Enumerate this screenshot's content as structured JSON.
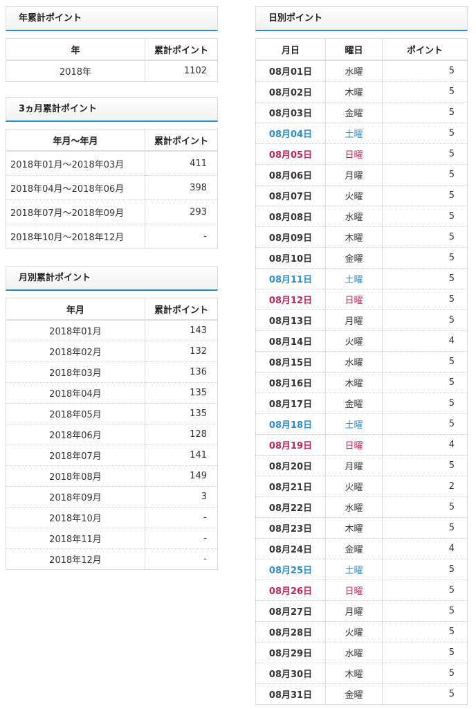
{
  "year_panel": {
    "title": "年累計ポイント",
    "headers": [
      "年",
      "累計ポイント"
    ],
    "rows": [
      {
        "period": "2018年",
        "points": "1102"
      }
    ]
  },
  "quarter_panel": {
    "title": "3ヵ月累計ポイント",
    "headers": [
      "年月～年月",
      "累計ポイント"
    ],
    "rows": [
      {
        "period": "2018年01月～2018年03月",
        "points": "411"
      },
      {
        "period": "2018年04月～2018年06月",
        "points": "398"
      },
      {
        "period": "2018年07月～2018年09月",
        "points": "293"
      },
      {
        "period": "2018年10月～2018年12月",
        "points": "-"
      }
    ]
  },
  "month_panel": {
    "title": "月別累計ポイント",
    "headers": [
      "年月",
      "累計ポイント"
    ],
    "rows": [
      {
        "period": "2018年01月",
        "points": "143"
      },
      {
        "period": "2018年02月",
        "points": "132"
      },
      {
        "period": "2018年03月",
        "points": "136"
      },
      {
        "period": "2018年04月",
        "points": "135"
      },
      {
        "period": "2018年05月",
        "points": "135"
      },
      {
        "period": "2018年06月",
        "points": "128"
      },
      {
        "period": "2018年07月",
        "points": "141"
      },
      {
        "period": "2018年08月",
        "points": "149"
      },
      {
        "period": "2018年09月",
        "points": "3"
      },
      {
        "period": "2018年10月",
        "points": "-"
      },
      {
        "period": "2018年11月",
        "points": "-"
      },
      {
        "period": "2018年12月",
        "points": "-"
      }
    ]
  },
  "daily_panel": {
    "title": "日別ポイント",
    "headers": [
      "月日",
      "曜日",
      "ポイント"
    ],
    "colors": {
      "saturday": "#2a8ccc",
      "sunday": "#c0245a",
      "accent": "#2a8ccc"
    },
    "rows": [
      {
        "date": "08月01日",
        "dow": "水曜",
        "points": "5",
        "day_type": "weekday"
      },
      {
        "date": "08月02日",
        "dow": "木曜",
        "points": "5",
        "day_type": "weekday"
      },
      {
        "date": "08月03日",
        "dow": "金曜",
        "points": "5",
        "day_type": "weekday"
      },
      {
        "date": "08月04日",
        "dow": "土曜",
        "points": "5",
        "day_type": "sat"
      },
      {
        "date": "08月05日",
        "dow": "日曜",
        "points": "5",
        "day_type": "sun"
      },
      {
        "date": "08月06日",
        "dow": "月曜",
        "points": "5",
        "day_type": "weekday"
      },
      {
        "date": "08月07日",
        "dow": "火曜",
        "points": "5",
        "day_type": "weekday"
      },
      {
        "date": "08月08日",
        "dow": "水曜",
        "points": "5",
        "day_type": "weekday"
      },
      {
        "date": "08月09日",
        "dow": "木曜",
        "points": "5",
        "day_type": "weekday"
      },
      {
        "date": "08月10日",
        "dow": "金曜",
        "points": "5",
        "day_type": "weekday"
      },
      {
        "date": "08月11日",
        "dow": "土曜",
        "points": "5",
        "day_type": "sat"
      },
      {
        "date": "08月12日",
        "dow": "日曜",
        "points": "5",
        "day_type": "sun"
      },
      {
        "date": "08月13日",
        "dow": "月曜",
        "points": "5",
        "day_type": "weekday"
      },
      {
        "date": "08月14日",
        "dow": "火曜",
        "points": "4",
        "day_type": "weekday"
      },
      {
        "date": "08月15日",
        "dow": "水曜",
        "points": "5",
        "day_type": "weekday"
      },
      {
        "date": "08月16日",
        "dow": "木曜",
        "points": "5",
        "day_type": "weekday"
      },
      {
        "date": "08月17日",
        "dow": "金曜",
        "points": "5",
        "day_type": "weekday"
      },
      {
        "date": "08月18日",
        "dow": "土曜",
        "points": "5",
        "day_type": "sat"
      },
      {
        "date": "08月19日",
        "dow": "日曜",
        "points": "4",
        "day_type": "sun"
      },
      {
        "date": "08月20日",
        "dow": "月曜",
        "points": "5",
        "day_type": "weekday"
      },
      {
        "date": "08月21日",
        "dow": "火曜",
        "points": "2",
        "day_type": "weekday"
      },
      {
        "date": "08月22日",
        "dow": "水曜",
        "points": "5",
        "day_type": "weekday"
      },
      {
        "date": "08月23日",
        "dow": "木曜",
        "points": "5",
        "day_type": "weekday"
      },
      {
        "date": "08月24日",
        "dow": "金曜",
        "points": "4",
        "day_type": "weekday"
      },
      {
        "date": "08月25日",
        "dow": "土曜",
        "points": "5",
        "day_type": "sat"
      },
      {
        "date": "08月26日",
        "dow": "日曜",
        "points": "5",
        "day_type": "sun"
      },
      {
        "date": "08月27日",
        "dow": "月曜",
        "points": "5",
        "day_type": "weekday"
      },
      {
        "date": "08月28日",
        "dow": "火曜",
        "points": "5",
        "day_type": "weekday"
      },
      {
        "date": "08月29日",
        "dow": "水曜",
        "points": "5",
        "day_type": "weekday"
      },
      {
        "date": "08月30日",
        "dow": "木曜",
        "points": "5",
        "day_type": "weekday"
      },
      {
        "date": "08月31日",
        "dow": "金曜",
        "points": "5",
        "day_type": "weekday"
      }
    ]
  }
}
